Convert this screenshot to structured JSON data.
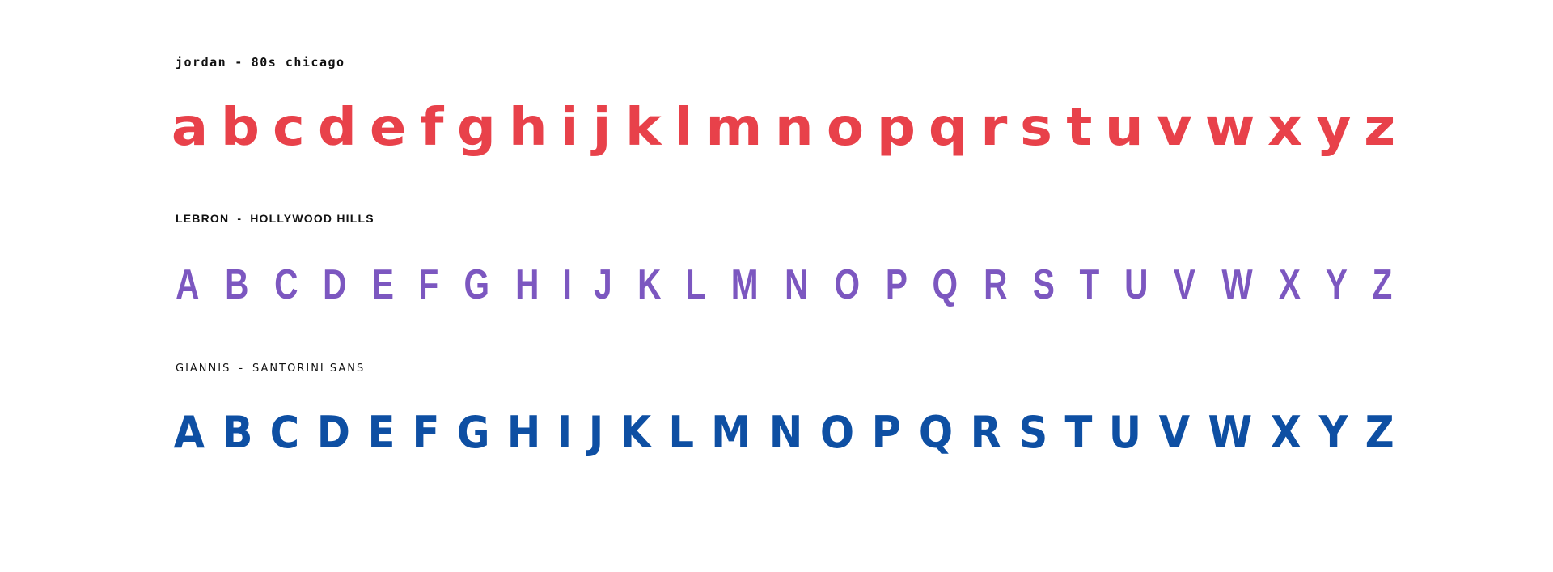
{
  "sections": {
    "jordan": {
      "name": "jordan",
      "separator": "-",
      "font_name": "80s chicago",
      "color": "#e8414a",
      "glyphs": [
        "a",
        "b",
        "c",
        "d",
        "e",
        "f",
        "g",
        "h",
        "i",
        "j",
        "k",
        "l",
        "m",
        "n",
        "o",
        "p",
        "q",
        "r",
        "s",
        "t",
        "u",
        "v",
        "w",
        "x",
        "y",
        "z"
      ]
    },
    "lebron": {
      "name": "LEBRON",
      "separator": "-",
      "font_name": "HOLLYWOOD HILLS",
      "color": "#7c57c0",
      "glyphs": [
        "A",
        "B",
        "C",
        "D",
        "E",
        "F",
        "G",
        "H",
        "I",
        "J",
        "K",
        "L",
        "M",
        "N",
        "O",
        "P",
        "Q",
        "R",
        "S",
        "T",
        "U",
        "V",
        "W",
        "X",
        "Y",
        "Z"
      ]
    },
    "giannis": {
      "name": "GIANNIS",
      "separator": "-",
      "font_name": "SANTORINI SANS",
      "color": "#0e4fa3",
      "glyphs": [
        "A",
        "B",
        "C",
        "D",
        "E",
        "F",
        "G",
        "H",
        "I",
        "J",
        "K",
        "L",
        "M",
        "N",
        "O",
        "P",
        "Q",
        "R",
        "S",
        "T",
        "U",
        "V",
        "W",
        "X",
        "Y",
        "Z"
      ]
    }
  }
}
